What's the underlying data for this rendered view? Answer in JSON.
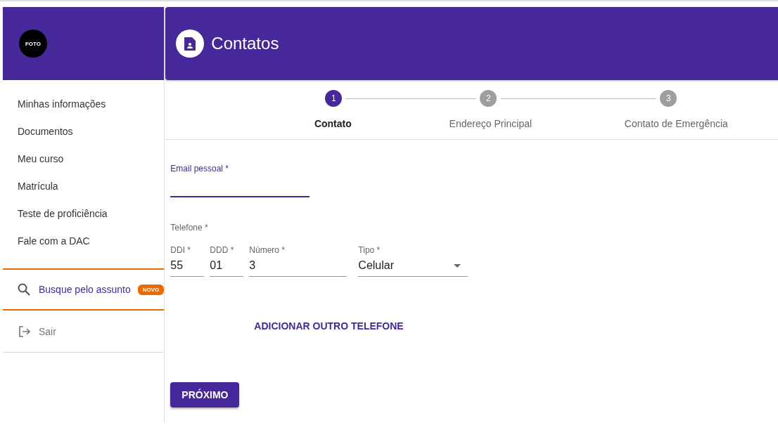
{
  "sidebar": {
    "photo_label": "FOTO",
    "items": [
      {
        "label": "Minhas informações"
      },
      {
        "label": "Documentos"
      },
      {
        "label": "Meu curso"
      },
      {
        "label": "Matrícula"
      },
      {
        "label": "Teste de proficiência"
      },
      {
        "label": "Fale com a DAC"
      }
    ],
    "search": {
      "label": "Busque pelo assunto",
      "badge": "NOVO"
    },
    "logout": "Sair"
  },
  "header": {
    "title": "Contatos"
  },
  "steps": [
    {
      "number": "1",
      "label": "Contato",
      "selected": true
    },
    {
      "number": "2",
      "label": "Endereço Principal",
      "selected": false
    },
    {
      "number": "3",
      "label": "Contato de Emergência",
      "selected": false
    }
  ],
  "email": {
    "label": "Email pessoal *",
    "focused": true
  },
  "phone": {
    "label": "Telefone *",
    "fields": [
      {
        "kind": "text",
        "label": "DDI *",
        "value": "55"
      },
      {
        "kind": "text",
        "label": "DDD *",
        "value": "01"
      },
      {
        "kind": "text",
        "label": "Número *",
        "value": "3"
      },
      {
        "kind": "select",
        "label": "Tipo *",
        "value": "Celular"
      }
    ]
  },
  "add_phone": "ADICIONAR OUTRO TELEFONE",
  "next": "PRÓXIMO"
}
